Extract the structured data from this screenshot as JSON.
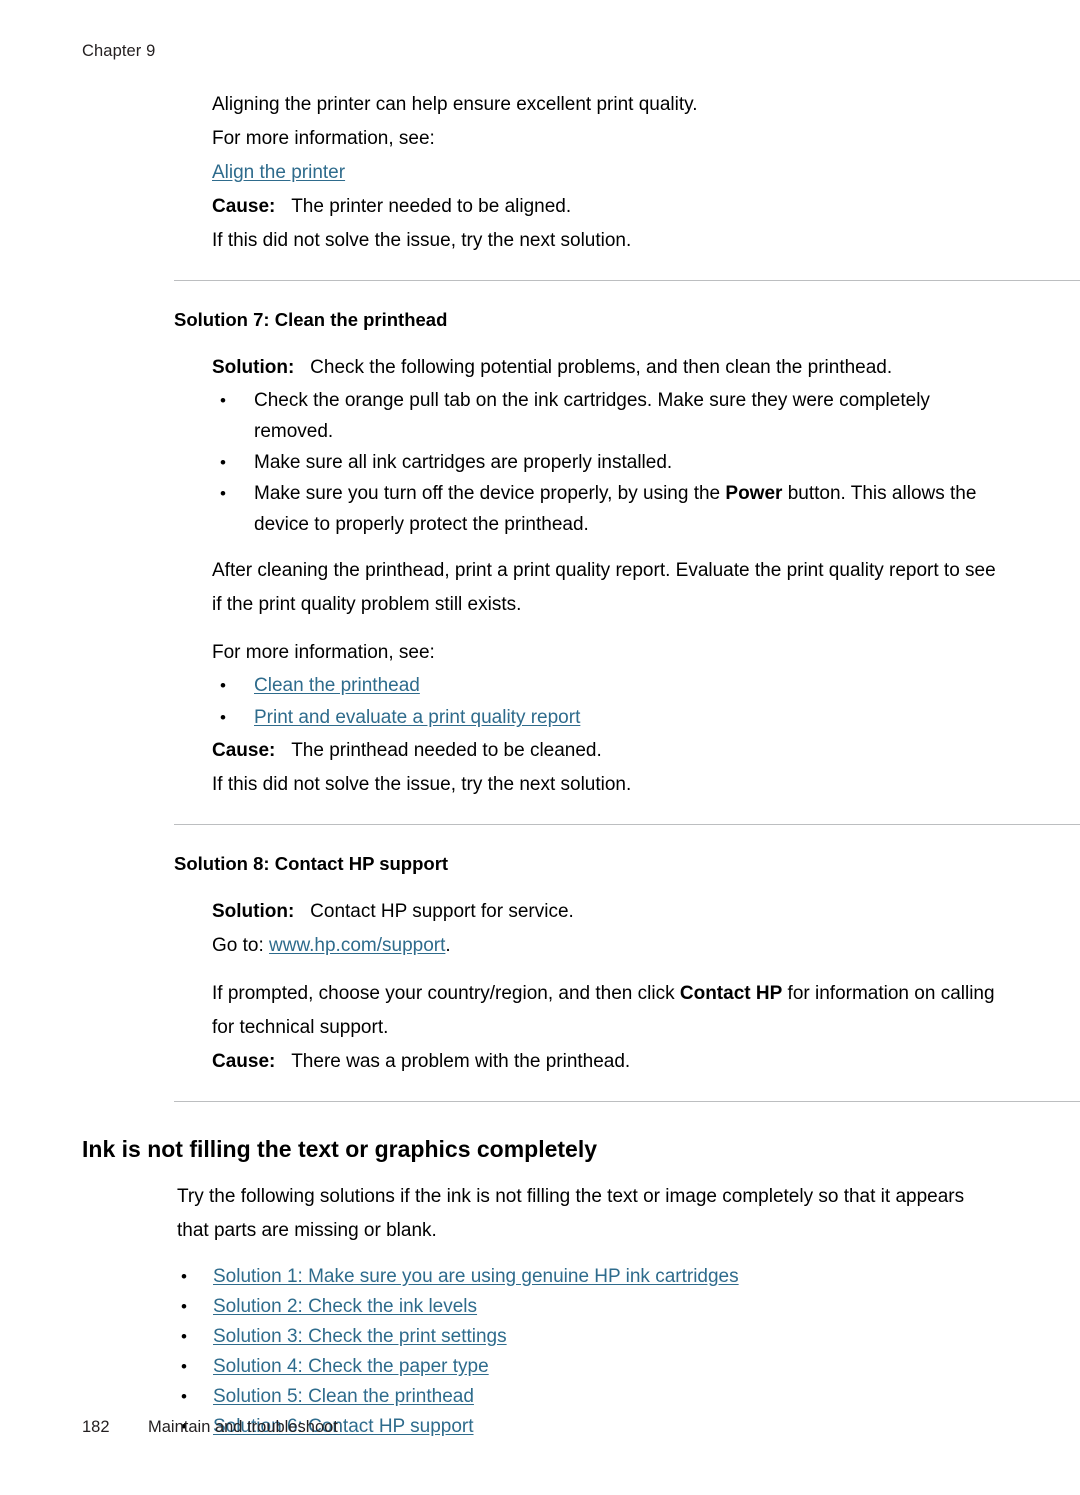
{
  "header": {
    "chapter": "Chapter 9"
  },
  "footer": {
    "page_number": "182",
    "section": "Maintain and troubleshoot"
  },
  "block1": {
    "line1": "Aligning the printer can help ensure excellent print quality.",
    "line2": "For more information, see:",
    "link": "Align the printer",
    "cause_label": "Cause:",
    "cause_text": "The printer needed to be aligned.",
    "next": "If this did not solve the issue, try the next solution."
  },
  "solution7": {
    "heading": "Solution 7: Clean the printhead",
    "solution_label": "Solution:",
    "solution_text": "Check the following potential problems, and then clean the printhead.",
    "bullets": [
      "Check the orange pull tab on the ink cartridges. Make sure they were completely removed.",
      "Make sure all ink cartridges are properly installed."
    ],
    "bullet3_pre": "Make sure you turn off the device properly, by using the ",
    "bullet3_bold": "Power",
    "bullet3_post": " button. This allows the device to properly protect the printhead.",
    "after_para": "After cleaning the printhead, print a print quality report. Evaluate the print quality report to see if the print quality problem still exists.",
    "more_info": "For more information, see:",
    "links": [
      "Clean the printhead",
      "Print and evaluate a print quality report"
    ],
    "cause_label": "Cause:",
    "cause_text": "The printhead needed to be cleaned.",
    "next": "If this did not solve the issue, try the next solution."
  },
  "solution8": {
    "heading": "Solution 8: Contact HP support",
    "solution_label": "Solution:",
    "solution_text": "Contact HP support for service.",
    "goto_pre": "Go to: ",
    "goto_link": "www.hp.com/support",
    "goto_post": ".",
    "prompt_pre": "If prompted, choose your country/region, and then click ",
    "prompt_bold": "Contact HP",
    "prompt_post": " for information on calling for technical support.",
    "cause_label": "Cause:",
    "cause_text": "There was a problem with the printhead."
  },
  "section_ink": {
    "title": "Ink is not filling the text or graphics completely",
    "intro": "Try the following solutions if the ink is not filling the text or image completely so that it appears that parts are missing or blank.",
    "links": [
      "Solution 1: Make sure you are using genuine HP ink cartridges",
      "Solution 2: Check the ink levels",
      "Solution 3: Check the print settings",
      "Solution 4: Check the paper type",
      "Solution 5: Clean the printhead",
      "Solution 6: Contact HP support"
    ]
  }
}
